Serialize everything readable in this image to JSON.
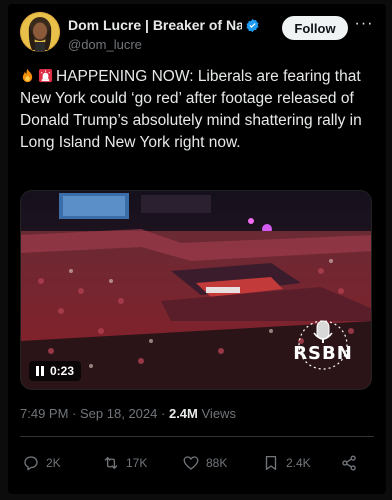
{
  "author": {
    "display_name": "Dom Lucre | Breaker of Narratives",
    "handle": "@dom_lucre",
    "verified": true,
    "avatar_icon": "avatar-portrait"
  },
  "follow_label": "Follow",
  "more_label": "···",
  "tweet": {
    "emojis": [
      "fire-emoji",
      "rotating-light-emoji"
    ],
    "text": "HAPPENING NOW: Liberals are fearing that New York could ‘go red’ after footage released of Donald Trump’s absolutely mind shattering rally in Long Island New York right now."
  },
  "video": {
    "duration": "0:23",
    "state": "playing",
    "watermark": "RSBN"
  },
  "meta": {
    "time": "7:49 PM",
    "separator": "·",
    "date": "Sep 18, 2024",
    "views_count": "2.4M",
    "views_label": "Views"
  },
  "actions": {
    "replies": "2K",
    "reposts": "17K",
    "likes": "88K",
    "bookmarks": "2.4K"
  },
  "colors": {
    "background": "#000000",
    "text": "#e7e9ea",
    "secondary": "#71767b",
    "verified": "#1d9bf0",
    "divider": "#2f3336"
  }
}
